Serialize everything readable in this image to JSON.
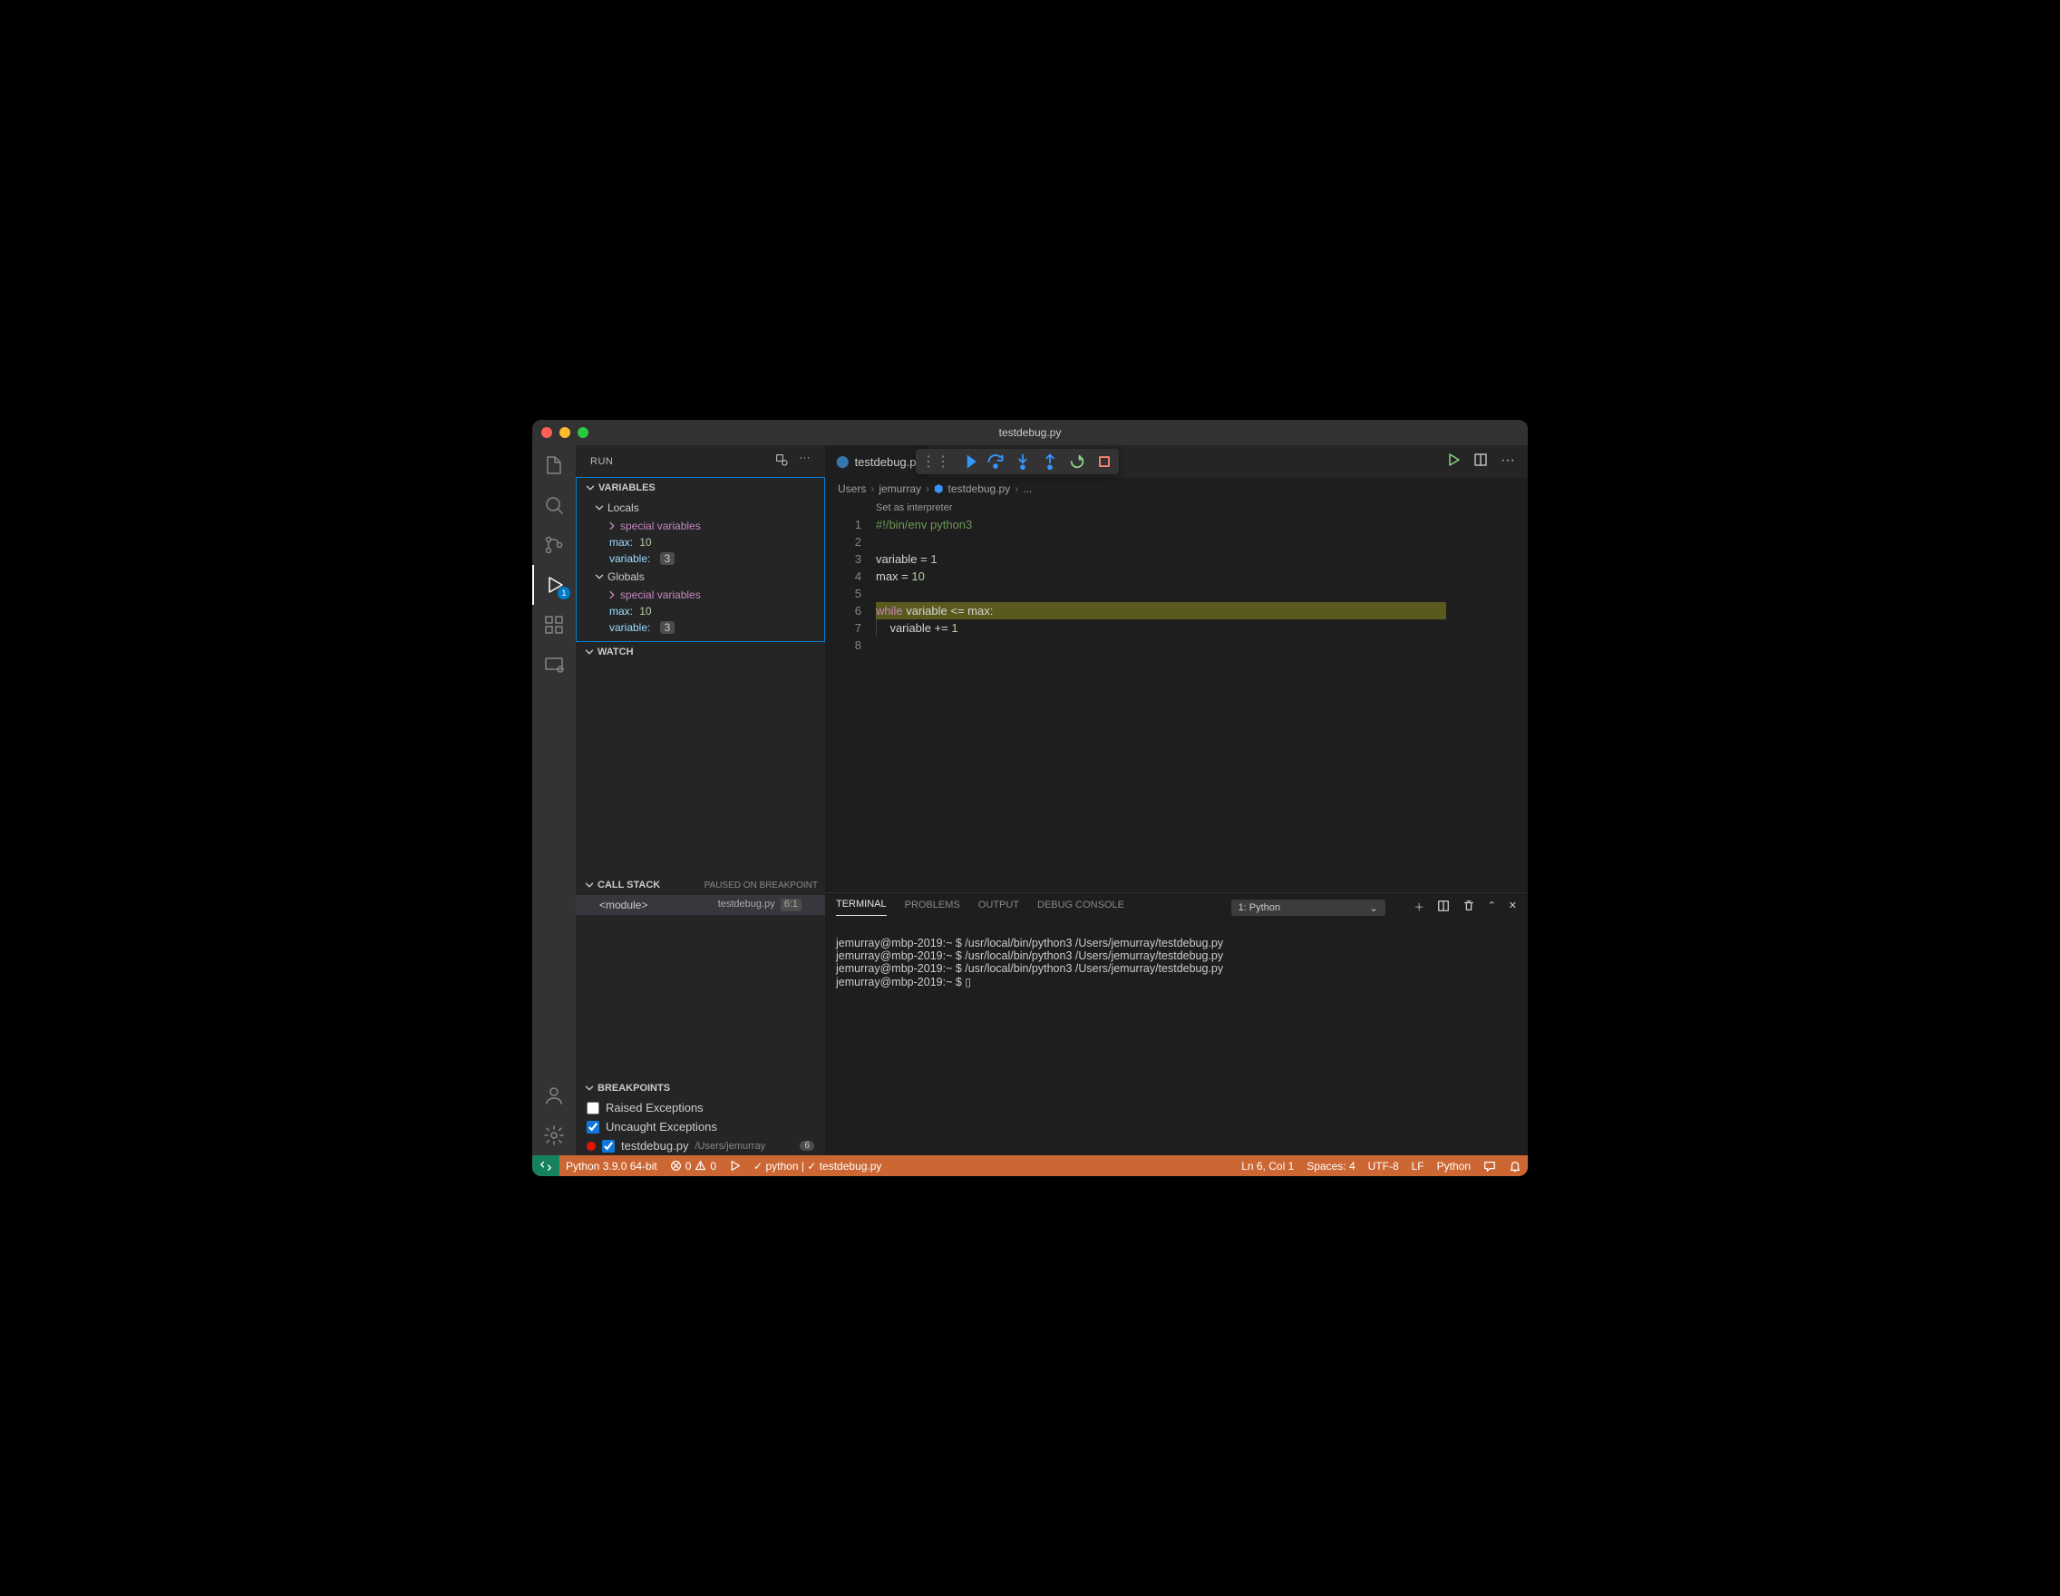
{
  "title": "testdebug.py",
  "sidebar": {
    "header": "RUN",
    "sections": {
      "variables": "VARIABLES",
      "watch": "WATCH",
      "callstack": "CALL STACK",
      "breakpoints": "BREAKPOINTS"
    },
    "scopes": {
      "locals": "Locals",
      "globals": "Globals",
      "special": "special variables"
    },
    "vars": {
      "max_name": "max:",
      "max_val": "10",
      "var_name": "variable:",
      "var_val": "3"
    },
    "cs_status": "PAUSED ON BREAKPOINT",
    "cs_frame": "<module>",
    "cs_file": "testdebug.py",
    "cs_loc": "6:1",
    "bp": {
      "raised": "Raised Exceptions",
      "uncaught": "Uncaught Exceptions",
      "file": "testdebug.py",
      "path": "/Users/jemurray",
      "count": "6"
    }
  },
  "tab": {
    "name": "testdebug.p"
  },
  "breadcrumb": {
    "p1": "Users",
    "p2": "jemurray",
    "p3": "testdebug.py",
    "p4": "..."
  },
  "codelens": "Set as interpreter",
  "code": {
    "l1": "#!/bin/env python3",
    "l3a": "variable ",
    "l3b": "= ",
    "l3c": "1",
    "l4a": "max ",
    "l4b": "= ",
    "l4c": "10",
    "l6a": "while",
    "l6b": " variable ",
    "l6c": "<=",
    "l6d": " max",
    "l6e": ":",
    "l7a": "    variable ",
    "l7b": "+= ",
    "l7c": "1"
  },
  "line_numbers": [
    "1",
    "2",
    "3",
    "4",
    "5",
    "6",
    "7",
    "8"
  ],
  "panel": {
    "tabs": {
      "terminal": "TERMINAL",
      "problems": "PROBLEMS",
      "output": "OUTPUT",
      "debug": "DEBUG CONSOLE"
    },
    "select": "1: Python"
  },
  "terminal": {
    "l1": "jemurray@mbp-2019:~ $ /usr/local/bin/python3 /Users/jemurray/testdebug.py",
    "l2": "jemurray@mbp-2019:~ $ /usr/local/bin/python3 /Users/jemurray/testdebug.py",
    "l3": "jemurray@mbp-2019:~ $ /usr/local/bin/python3 /Users/jemurray/testdebug.py",
    "l4": "jemurray@mbp-2019:~ $ ▯"
  },
  "statusbar": {
    "python": "Python 3.9.0 64-bit",
    "errors": "0",
    "warnings": "0",
    "tests": "✓ python | ✓ testdebug.py",
    "pos": "Ln 6, Col 1",
    "spaces": "Spaces: 4",
    "enc": "UTF-8",
    "eol": "LF",
    "lang": "Python"
  }
}
